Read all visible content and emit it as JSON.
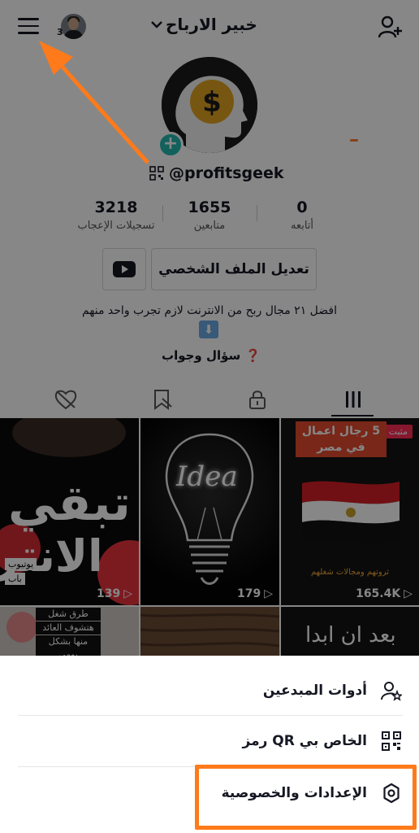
{
  "header": {
    "title": "خبير الارباح",
    "notification_count": "3"
  },
  "profile": {
    "username": "@profitsgeek",
    "stats": [
      {
        "value": "3218",
        "label": "تسجيلات الإعجاب"
      },
      {
        "value": "1655",
        "label": "متابعين"
      },
      {
        "value": "0",
        "label": "أتابعه"
      }
    ],
    "edit_button": "تعديل الملف الشخصي",
    "bio": "افضل ٢١ مجال ربح من الانترنت لازم تجرب واحد منهم",
    "emoji": "⬇",
    "qa_label": "سؤال وجواب"
  },
  "grid": {
    "cells": [
      {
        "overlay_text": "تبقي",
        "overlay_text_2": "الانتر",
        "views": "139",
        "small_1": "يوتيوب",
        "small_2": "باب"
      },
      {
        "overlay_text": "Idea",
        "views": "179"
      },
      {
        "pinned": "مثبت",
        "banner": "5 رجال اعمال في مصر",
        "caption": "ثروتهم ومجالات شغلهم",
        "views": "165.4K"
      },
      {
        "caption_lines": [
          "طرق شغل",
          "هتشوف العائد",
          "منها بشكل يومي"
        ]
      },
      {},
      {
        "overlay_text": "بعد ان ابدا"
      }
    ]
  },
  "sheet": {
    "items": [
      {
        "label": "أدوات المبدعين",
        "icon": "creator-tools-icon"
      },
      {
        "label": "رمز QR الخاص بي",
        "icon": "qr-code-icon"
      },
      {
        "label": "الإعدادات والخصوصية",
        "icon": "gear-icon"
      }
    ]
  },
  "colors": {
    "accent": "#fe2c55",
    "teal": "#22b8b0",
    "annotation_orange": "#ff7a1a"
  }
}
